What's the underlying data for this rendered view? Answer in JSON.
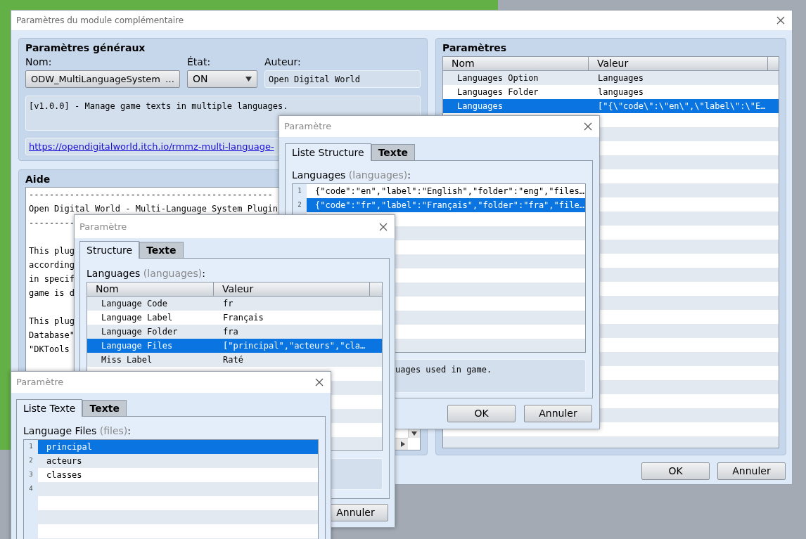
{
  "main_window": {
    "title": "Paramètres du module complémentaire",
    "general": {
      "title": "Paramètres généraux",
      "name": {
        "label": "Nom:",
        "value": "ODW_MultiLanguageSystem",
        "button": "…"
      },
      "state": {
        "label": "État:",
        "value": "ON"
      },
      "author": {
        "label": "Auteur:",
        "value": "Open Digital World"
      },
      "description": "[v1.0.0] - Manage game texts in multiple languages.",
      "link": "https://opendigitalworld.itch.io/rmmz-multi-language-"
    },
    "help": {
      "title": "Aide",
      "paragraphs": [
        [
          "------------------------------------------------",
          "Open Digital World - Multi-Language System Plugin",
          "---------"
        ],
        [
          "This plug",
          "according",
          "in specif",
          "game is d"
        ],
        [
          "This plug",
          "Database\"",
          "\"DKTools"
        ]
      ]
    },
    "parameters": {
      "title": "Paramètres",
      "columns": [
        "Nom",
        "Valeur"
      ],
      "rows": [
        {
          "name": "Languages Option",
          "value": "Languages",
          "selected": false
        },
        {
          "name": "Languages Folder",
          "value": "languages",
          "selected": false
        },
        {
          "name": "Languages",
          "value": "[\"{\\\"code\\\":\\\"en\\\",\\\"label\\\":\\\"E…",
          "selected": true
        }
      ]
    },
    "buttons": [
      "OK",
      "Annuler"
    ]
  },
  "list_dialog": {
    "title": "Paramètre",
    "tabs": [
      {
        "label": "Liste Structure",
        "selected": true
      },
      {
        "label": "Texte",
        "selected": false
      }
    ],
    "field": {
      "label": "Languages",
      "key": "(languages)",
      "colon": ":"
    },
    "items": [
      {
        "number": "1",
        "text": "{\"code\":\"en\",\"label\":\"English\",\"folder\":\"eng\",\"files…",
        "selected": false
      },
      {
        "number": "2",
        "text": "{\"code\":\"fr\",\"label\":\"Français\",\"folder\":\"fra\",\"file…",
        "selected": true
      }
    ],
    "description": "uages used in game.",
    "buttons": [
      "OK",
      "Annuler"
    ]
  },
  "structure_dialog": {
    "title": "Paramètre",
    "tabs": [
      {
        "label": "Structure",
        "selected": true
      },
      {
        "label": "Texte",
        "selected": false
      }
    ],
    "field": {
      "label": "Languages",
      "key": "(languages)",
      "colon": ":"
    },
    "columns": [
      "Nom",
      "Valeur"
    ],
    "rows": [
      {
        "name": "Language Code",
        "value": "fr",
        "selected": false
      },
      {
        "name": "Language Label",
        "value": "Français",
        "selected": false
      },
      {
        "name": "Language Folder",
        "value": "fra",
        "selected": false
      },
      {
        "name": "Language Files",
        "value": "[\"principal\",\"acteurs\",\"cla…",
        "selected": true
      },
      {
        "name": "Miss Label",
        "value": "Raté",
        "selected": false
      }
    ],
    "buttons": [
      "Annuler"
    ]
  },
  "text_list_dialog": {
    "title": "Paramètre",
    "tabs": [
      {
        "label": "Liste Texte",
        "selected": true
      },
      {
        "label": "Texte",
        "selected": false
      }
    ],
    "field": {
      "label": "Language Files",
      "key": "(files)",
      "colon": ":"
    },
    "items": [
      {
        "number": "1",
        "text": "principal",
        "selected": true
      },
      {
        "number": "2",
        "text": "acteurs",
        "selected": false
      },
      {
        "number": "3",
        "text": "classes",
        "selected": false
      },
      {
        "number": "4",
        "selected": false
      }
    ]
  }
}
